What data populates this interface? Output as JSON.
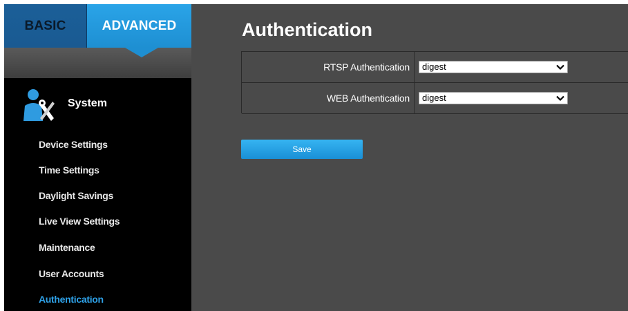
{
  "tabs": {
    "basic": "BASIC",
    "advanced": "ADVANCED"
  },
  "section": {
    "label": "System",
    "icon": "system-tools-user-icon"
  },
  "menu": {
    "items": [
      {
        "label": "Device Settings",
        "active": false
      },
      {
        "label": "Time Settings",
        "active": false
      },
      {
        "label": "Daylight Savings",
        "active": false
      },
      {
        "label": "Live View Settings",
        "active": false
      },
      {
        "label": "Maintenance",
        "active": false
      },
      {
        "label": "User Accounts",
        "active": false
      },
      {
        "label": "Authentication",
        "active": true
      }
    ]
  },
  "main": {
    "title": "Authentication",
    "rows": [
      {
        "label": "RTSP Authentication",
        "value": "digest"
      },
      {
        "label": "WEB Authentication",
        "value": "digest"
      }
    ],
    "save_label": "Save"
  },
  "colors": {
    "accent": "#1e8fd2",
    "active_menu": "#2ea0e6",
    "panel_bg": "#4a4a4a",
    "sidebar_bg": "#000000"
  }
}
